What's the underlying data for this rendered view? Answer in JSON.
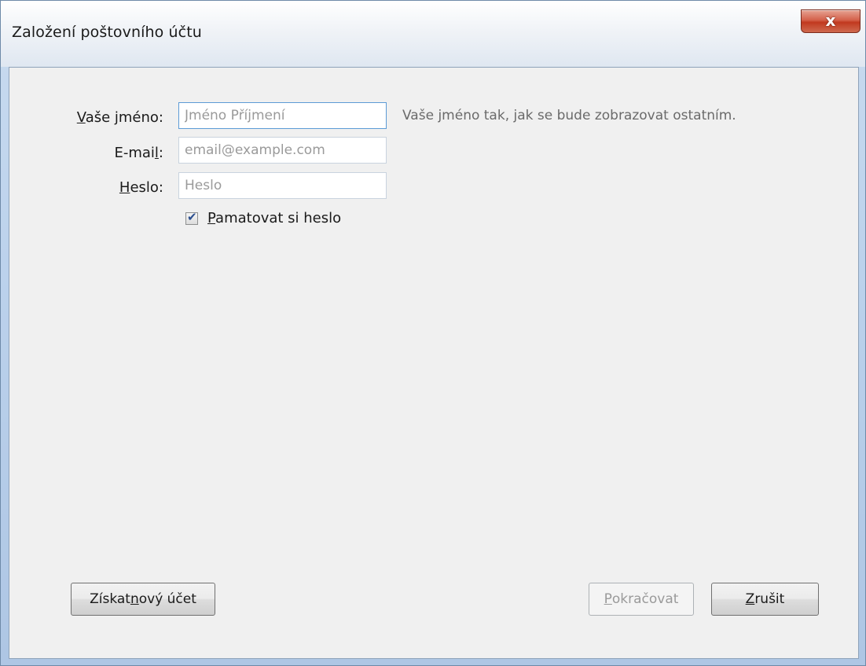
{
  "window": {
    "title": "Založení poštovního účtu",
    "close_label": "x"
  },
  "form": {
    "name_label_accel": "V",
    "name_label_rest": "aše jméno:",
    "name_placeholder": "Jméno Příjmení",
    "name_hint": "Vaše jméno tak, jak se bude zobrazovat ostatním.",
    "email_label_start": "E-mai",
    "email_label_accel": "l",
    "email_label_end": ":",
    "email_placeholder": "email@example.com",
    "password_label_accel": "H",
    "password_label_rest": "eslo:",
    "password_placeholder": "Heslo",
    "remember_accel": "P",
    "remember_rest": "amatovat si heslo",
    "remember_checked": true
  },
  "buttons": {
    "get_account_start": "Získat ",
    "get_account_accel": "n",
    "get_account_end": "ový účet",
    "continue_accel": "P",
    "continue_rest": "okračovat",
    "continue_disabled": true,
    "cancel_accel": "Z",
    "cancel_rest": "rušit"
  },
  "colors": {
    "client_bg": "#f0f0f0",
    "hint_text": "#6a6a6a",
    "close_button": "#c1391f"
  }
}
